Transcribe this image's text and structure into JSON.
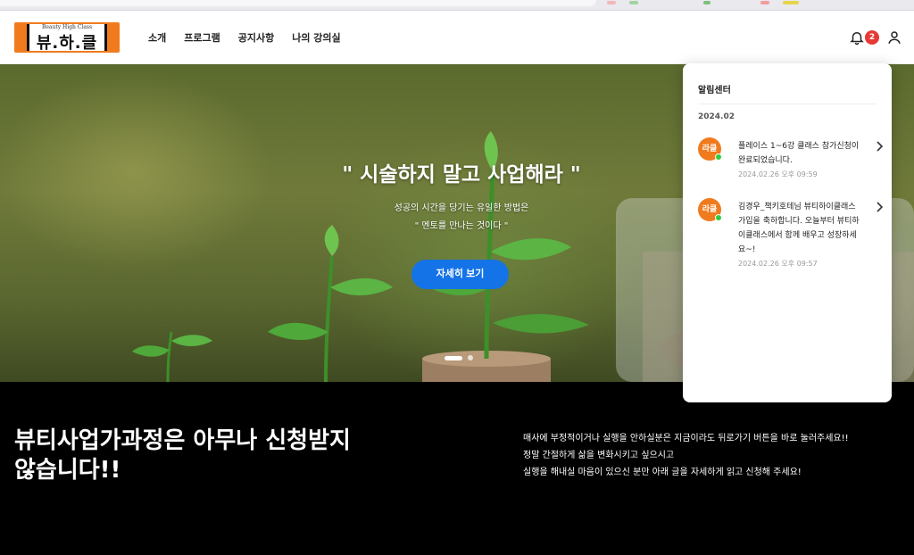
{
  "header": {
    "logo_small": "Beauty High Class",
    "logo_big": "뷰.하.클",
    "nav": [
      "소개",
      "프로그램",
      "공지사항",
      "나의 강의실"
    ],
    "notification_count": "2"
  },
  "hero": {
    "title": "\" 시술하지 말고 사업해라 \"",
    "subtitle_1": "성공의 시간을 당기는 유일한 방법은",
    "subtitle_2": "\" 멘토를 만나는 것이다 \"",
    "button_label": "자세히 보기",
    "slide_count": 2,
    "active_slide": 1
  },
  "bottom": {
    "title_line1": "뷰티사업가과정은 아무나 신청받지",
    "title_line2": "않습니다!!",
    "text_line1": "매사에 부정적이거나 실행을 안하실분은 지금이라도 뒤로가기 버튼을 바로 눌러주세요!!",
    "text_line2": "정말 간절하게 삶을 변화시키고 싶으시고",
    "text_line3": "실행을 해내실 마음이 있으신 분만 아래 글을 자세하게 읽고 신청해 주세요!"
  },
  "notifications": {
    "title": "알림센터",
    "month": "2024.02",
    "items": [
      {
        "avatar": "라클",
        "message": "플레이스 1~6강 클래스 참가신청이 완료되었습니다.",
        "time": "2024.02.26 오후 09:59"
      },
      {
        "avatar": "라클",
        "message": "김경우_책키호테님 뷰티하이클래스 가입을 축하합니다. 오늘부터 뷰티하이클래스에서 함께 배우고 성장하세요~!",
        "time": "2024.02.26 오후 09:57"
      }
    ]
  },
  "colors": {
    "brand_orange": "#f07b1e",
    "button_blue": "#1473e6",
    "badge_red": "#e53935",
    "online_green": "#2ecc40"
  }
}
